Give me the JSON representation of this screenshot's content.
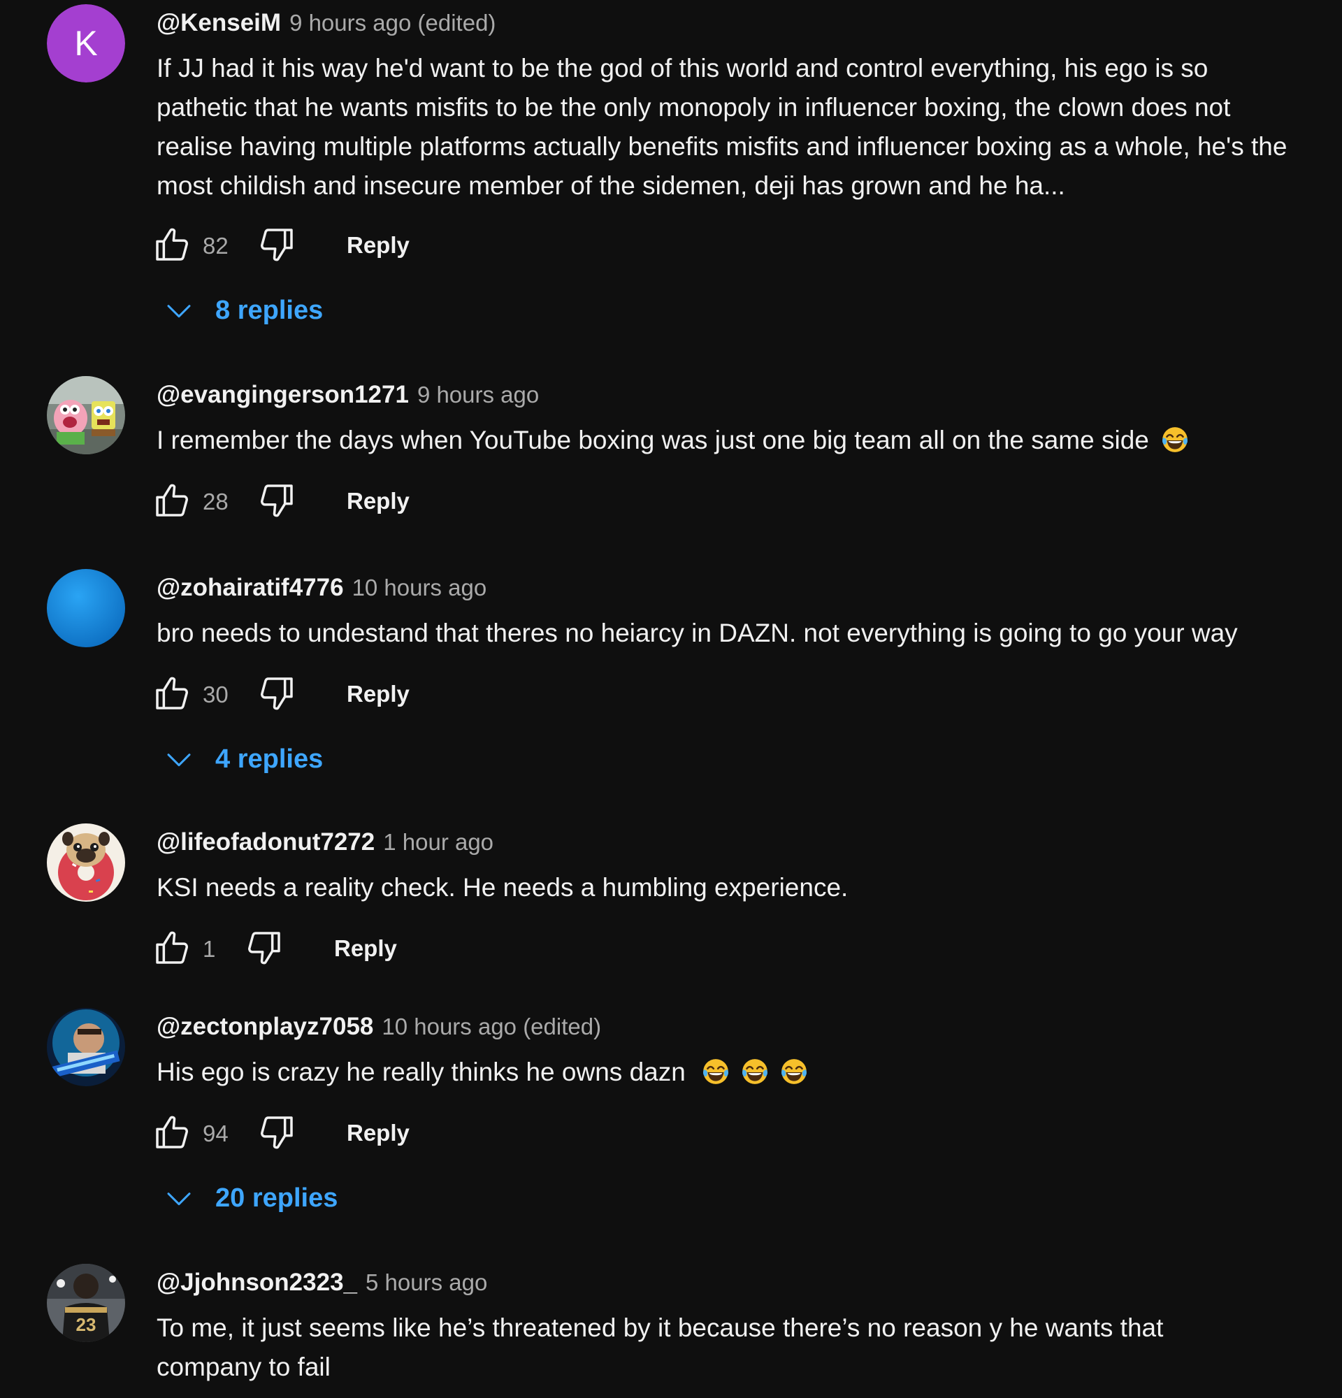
{
  "icons": {
    "like": "thumbs-up-icon",
    "dislike": "thumbs-down-icon",
    "expand": "chevron-down-icon",
    "emoji": "face-with-tears-of-joy-emoji"
  },
  "colors": {
    "background": "#0f0f0f",
    "text": "#f1f1f1",
    "secondary": "#aaaaaa",
    "link": "#3ea6ff",
    "avatar_k": "#a43fd0",
    "avatar_blue": "#1e88e5"
  },
  "comments": [
    {
      "author": "@KenseiM",
      "time": "9 hours ago (edited)",
      "avatar_letter": "K",
      "text": "If JJ had it his way he'd want to be the god of this world and control everything, his ego is so pathetic that he wants misfits to be the only monopoly in influencer boxing, the clown does not realise having multiple platforms actually benefits misfits and influencer boxing as a whole, he's the most childish and insecure member of the sidemen, deji has grown and he ha...",
      "likes": "82",
      "reply_label": "Reply",
      "replies": "8 replies"
    },
    {
      "author": "@evangingerson1271",
      "time": "9 hours ago",
      "text": "I remember the days when YouTube boxing was just one big team all on the same side",
      "likes": "28",
      "reply_label": "Reply"
    },
    {
      "author": "@zohairatif4776",
      "time": "10 hours ago",
      "text": "bro needs to undestand that theres no heiarcy in DAZN. not everything is going to go your way",
      "likes": "30",
      "reply_label": "Reply",
      "replies": "4 replies"
    },
    {
      "author": "@lifeofadonut7272",
      "time": "1 hour ago",
      "text": "KSI needs a reality check. He needs a humbling experience.",
      "likes": "1",
      "reply_label": "Reply"
    },
    {
      "author": "@zectonplayz7058",
      "time": "10 hours ago (edited)",
      "text": "His ego is crazy he really thinks he owns dazn",
      "likes": "94",
      "reply_label": "Reply",
      "replies": "20 replies"
    },
    {
      "author": "@Jjohnson2323_",
      "time": "5 hours ago",
      "text": "To me, it just seems like he’s threatened by it because there’s no reason y  he wants that company to fail"
    }
  ]
}
